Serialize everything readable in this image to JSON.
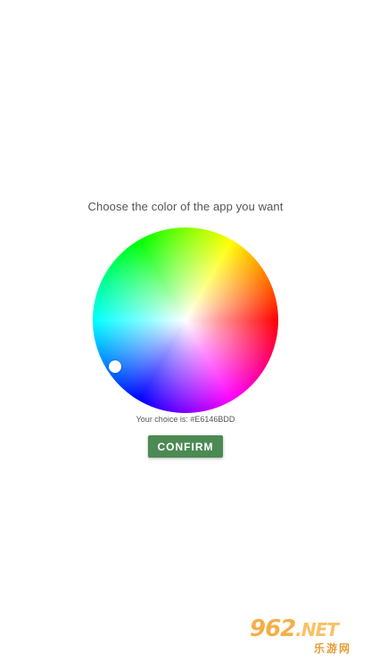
{
  "prompt_text": "Choose the color of the app you want",
  "choice_text": "Your choice is: #E6146BDD",
  "confirm_label": "CONFIRM",
  "watermark": {
    "main": "962",
    "net": ".NET",
    "sub": "乐游网"
  },
  "colors": {
    "button": "#4c8a53",
    "selected_color": "#E6146BDD",
    "text": "#555555"
  }
}
